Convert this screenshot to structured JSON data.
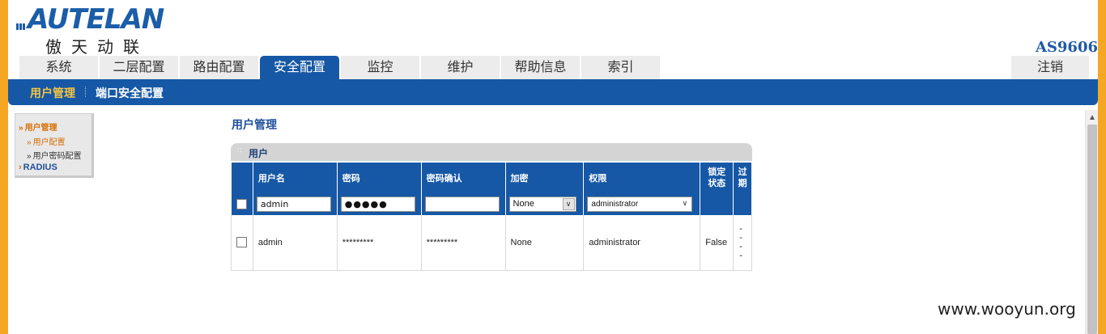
{
  "brand": {
    "logo_text": "AUTELAN",
    "logo_sub": "傲天动联",
    "model": "AS9606"
  },
  "tabs": [
    {
      "label": "系统",
      "active": false
    },
    {
      "label": "二层配置",
      "active": false
    },
    {
      "label": "路由配置",
      "active": false
    },
    {
      "label": "安全配置",
      "active": true
    },
    {
      "label": "监控",
      "active": false
    },
    {
      "label": "维护",
      "active": false
    },
    {
      "label": "帮助信息",
      "active": false
    },
    {
      "label": "索引",
      "active": false
    }
  ],
  "logout_label": "注销",
  "subnav": {
    "item1": "用户管理",
    "item2": "端口安全配置"
  },
  "leftnav": {
    "group": "用户管理",
    "items": [
      "用户配置",
      "用户密码配置"
    ],
    "radius": "RADIUS"
  },
  "page_title": "用户管理",
  "panel_title": "用户",
  "table": {
    "headers": {
      "username": "用户名",
      "password": "密码",
      "password_confirm": "密码确认",
      "encrypt": "加密",
      "privilege": "权限",
      "lock_status_1": "锁定",
      "lock_status_2": "状态",
      "expire_1": "过",
      "expire_2": "期"
    },
    "input_row": {
      "username_value": "admin",
      "password_value": "●●●●●",
      "password_confirm_value": "",
      "encrypt_value": "None",
      "privilege_value": "administrator"
    },
    "rows": [
      {
        "username": "admin",
        "password": "*********",
        "password_confirm": "*********",
        "encrypt": "None",
        "privilege": "administrator",
        "locked": "False",
        "expire": [
          "-",
          "-",
          "-",
          "-"
        ]
      }
    ]
  },
  "watermark": "www.wooyun.org",
  "colors": {
    "nav_blue": "#1658a6",
    "accent_orange": "#d86c00",
    "outer_orange": "#f5a623"
  }
}
